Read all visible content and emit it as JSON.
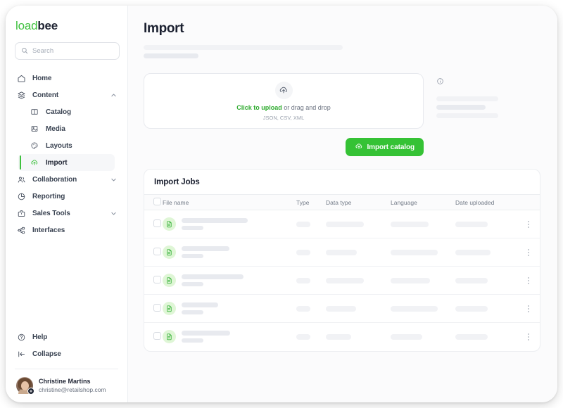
{
  "brand": {
    "name_first": "load",
    "name_second": "bee",
    "accent": "#3fc13f"
  },
  "search": {
    "placeholder": "Search",
    "value": ""
  },
  "sidebar": {
    "items": [
      {
        "label": "Home",
        "icon": "home-icon",
        "expandable": false
      },
      {
        "label": "Content",
        "icon": "layers-icon",
        "expandable": true,
        "state": "expanded"
      },
      {
        "label": "Collaboration",
        "icon": "users-icon",
        "expandable": true,
        "state": "collapsed"
      },
      {
        "label": "Reporting",
        "icon": "pie-chart-icon",
        "expandable": false
      },
      {
        "label": "Sales Tools",
        "icon": "briefcase-icon",
        "expandable": true,
        "state": "collapsed"
      },
      {
        "label": "Interfaces",
        "icon": "nodes-icon",
        "expandable": false
      }
    ],
    "content_children": [
      {
        "label": "Catalog",
        "icon": "book-icon",
        "active": false
      },
      {
        "label": "Media",
        "icon": "image-icon",
        "active": false
      },
      {
        "label": "Layouts",
        "icon": "palette-icon",
        "active": false
      },
      {
        "label": "Import",
        "icon": "cloud-upload-icon",
        "active": true
      }
    ],
    "footer": [
      {
        "label": "Help",
        "icon": "help-circle-icon"
      },
      {
        "label": "Collapse",
        "icon": "collapse-left-icon"
      }
    ],
    "profile": {
      "name": "Christine Martins",
      "email": "christine@retailshop.com",
      "badge_icon": "gear-icon"
    }
  },
  "main": {
    "title": "Import",
    "upload": {
      "icon": "cloud-upload-icon",
      "link_label": "Click to upload",
      "rest_label": " or drag and drop",
      "formats": "JSON, CSV, XML"
    },
    "import_button": {
      "label": "Import catalog",
      "icon": "cloud-upload-icon",
      "color": "#35c235"
    },
    "info": {
      "icon": "info-circle-icon"
    },
    "table": {
      "title": "Import Jobs",
      "columns": [
        "File name",
        "Type",
        "Data type",
        "Language",
        "Date uploaded"
      ],
      "rows": [
        {
          "icon": "file-text-icon",
          "name_w": 94,
          "sub_w": 31,
          "type_w": 20,
          "data_w": 54,
          "lang_w": 54,
          "date_w": 46,
          "menu": "kebab-menu-icon"
        },
        {
          "icon": "file-text-icon",
          "name_w": 68,
          "sub_w": 31,
          "type_w": 20,
          "data_w": 44,
          "lang_w": 67,
          "date_w": 50,
          "menu": "kebab-menu-icon"
        },
        {
          "icon": "file-text-icon",
          "name_w": 88,
          "sub_w": 31,
          "type_w": 20,
          "data_w": 54,
          "lang_w": 56,
          "date_w": 46,
          "menu": "kebab-menu-icon"
        },
        {
          "icon": "file-text-icon",
          "name_w": 52,
          "sub_w": 31,
          "type_w": 20,
          "data_w": 43,
          "lang_w": 67,
          "date_w": 46,
          "menu": "kebab-menu-icon"
        },
        {
          "icon": "file-text-icon",
          "name_w": 69,
          "sub_w": 31,
          "type_w": 20,
          "data_w": 36,
          "lang_w": 45,
          "date_w": 46,
          "menu": "kebab-menu-icon"
        }
      ]
    }
  }
}
